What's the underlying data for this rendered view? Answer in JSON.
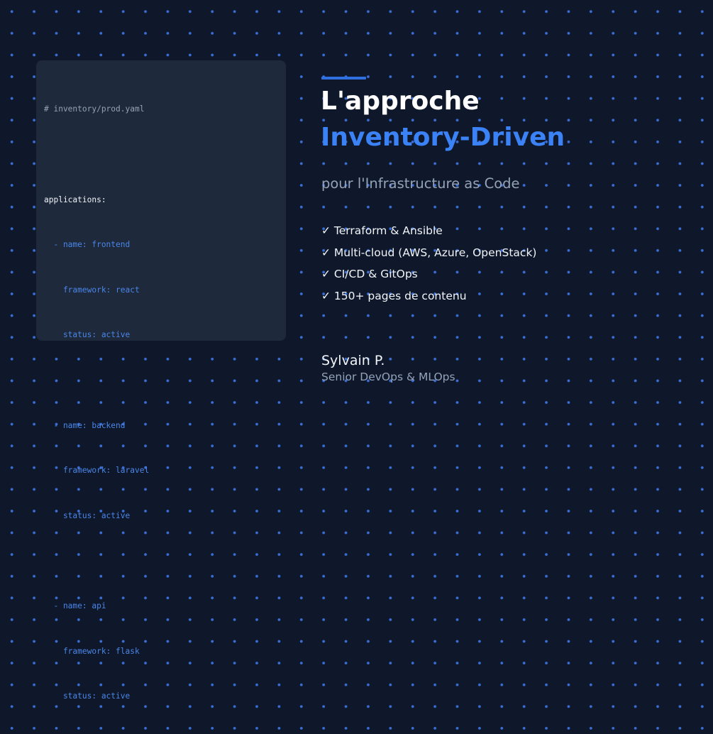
{
  "code": {
    "lines": [
      {
        "text": "# inventory/prod.yaml",
        "kind": "comment"
      },
      {
        "text": "",
        "kind": "blank"
      },
      {
        "text": "applications:",
        "kind": "key"
      },
      {
        "text": "  - name: frontend",
        "kind": "val"
      },
      {
        "text": "    framework: react",
        "kind": "val"
      },
      {
        "text": "    status: active",
        "kind": "val"
      },
      {
        "text": "",
        "kind": "blank"
      },
      {
        "text": "  - name: backend",
        "kind": "val"
      },
      {
        "text": "    framework: laravel",
        "kind": "val"
      },
      {
        "text": "    status: active",
        "kind": "val"
      },
      {
        "text": "",
        "kind": "blank"
      },
      {
        "text": "  - name: api",
        "kind": "val"
      },
      {
        "text": "    framework: flask",
        "kind": "val"
      },
      {
        "text": "    status: active",
        "kind": "val"
      }
    ]
  },
  "hero": {
    "title_line1": "L'approche",
    "title_line2": "Inventory-Driven",
    "subtitle": "pour l'Infrastructure as Code"
  },
  "features": [
    "✓ Terraform & Ansible",
    "✓ Multi-cloud (AWS, Azure, OpenStack)",
    "✓ CI/CD & GitOps",
    "✓ 150+ pages de contenu"
  ],
  "author": {
    "name": "Sylvain P.",
    "role": "Senior DevOps & MLOps"
  },
  "colors": {
    "background": "#0f172a",
    "panel": "#1e293b",
    "accent": "#3b82f6",
    "dots": "#3b6fd8",
    "muted_text": "#94a3b8"
  }
}
